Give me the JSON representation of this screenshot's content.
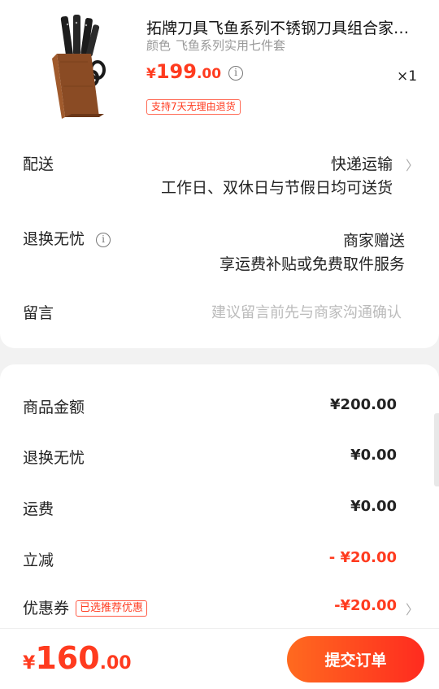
{
  "product": {
    "image": "knife-block-icon",
    "title": "拓牌刀具飞鱼系列不锈钢刀具组合家…",
    "variant_label": "颜色",
    "variant_value": "飞鱼系列实用七件套",
    "price_currency": "¥",
    "price_int": "199",
    "price_dec": ".00",
    "qty_x": "×",
    "qty": "1",
    "return_badge": "支持7天无理由退货"
  },
  "rows": {
    "delivery_label": "配送",
    "delivery_value": "快递运输",
    "delivery_note": "工作日、双休日与节假日均可送货",
    "exchange_label": "退换无忧",
    "exchange_value": "商家赠送",
    "exchange_note": "享运费补贴或免费取件服务",
    "message_label": "留言",
    "message_placeholder": "建议留言前先与商家沟通确认"
  },
  "summary": {
    "goods_label": "商品金额",
    "goods_value": "¥200.00",
    "exchange_label": "退换无忧",
    "exchange_value": "¥0.00",
    "shipping_label": "运费",
    "shipping_value": "¥0.00",
    "discount_label": "立减",
    "discount_value": "- ¥20.00",
    "coupon_label": "优惠券",
    "coupon_tag": "已选推荐优惠",
    "coupon_value": "-¥20.00"
  },
  "footer": {
    "total_currency": "¥",
    "total_int": "160",
    "total_dec": ".00",
    "submit_label": "提交订单"
  },
  "colors": {
    "accent": "#ff3b1f",
    "background": "#f2f2f2"
  }
}
